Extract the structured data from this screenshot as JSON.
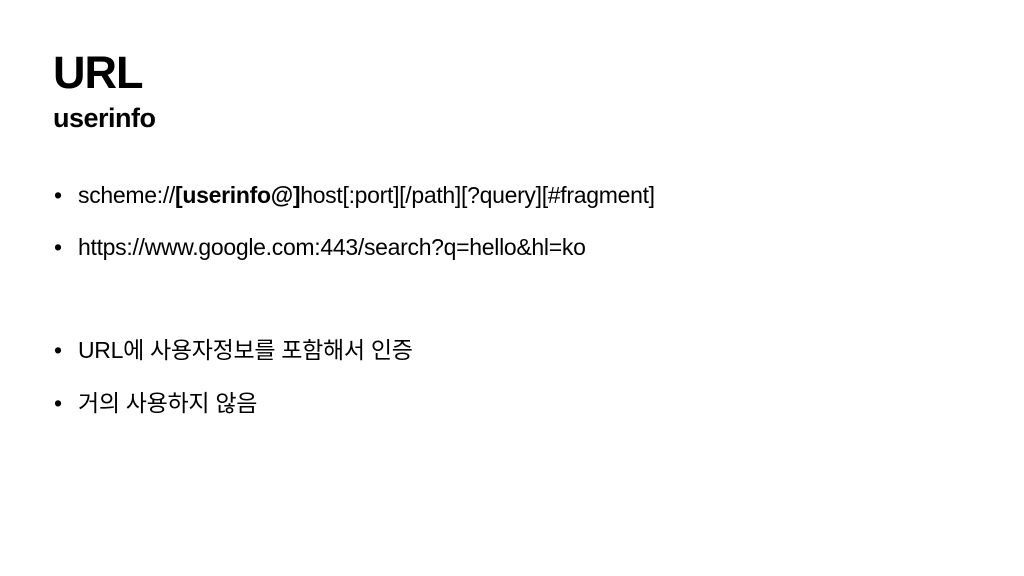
{
  "slide": {
    "title": "URL",
    "subtitle": "userinfo",
    "bullet_glyph": "•",
    "bullets": [
      {
        "parts": [
          {
            "text": "scheme://",
            "bold": false
          },
          {
            "text": "[userinfo@]",
            "bold": true
          },
          {
            "text": "host[:port][/path][?query][#fragment]",
            "bold": false
          }
        ]
      },
      {
        "parts": [
          {
            "text": "https://www.google.com:443/search?q=hello&hl=ko",
            "bold": false
          }
        ]
      },
      {
        "parts": [
          {
            "text": "URL에 사용자정보를 포함해서 인증",
            "bold": false
          }
        ]
      },
      {
        "parts": [
          {
            "text": "거의 사용하지 않음",
            "bold": false
          }
        ]
      }
    ]
  }
}
